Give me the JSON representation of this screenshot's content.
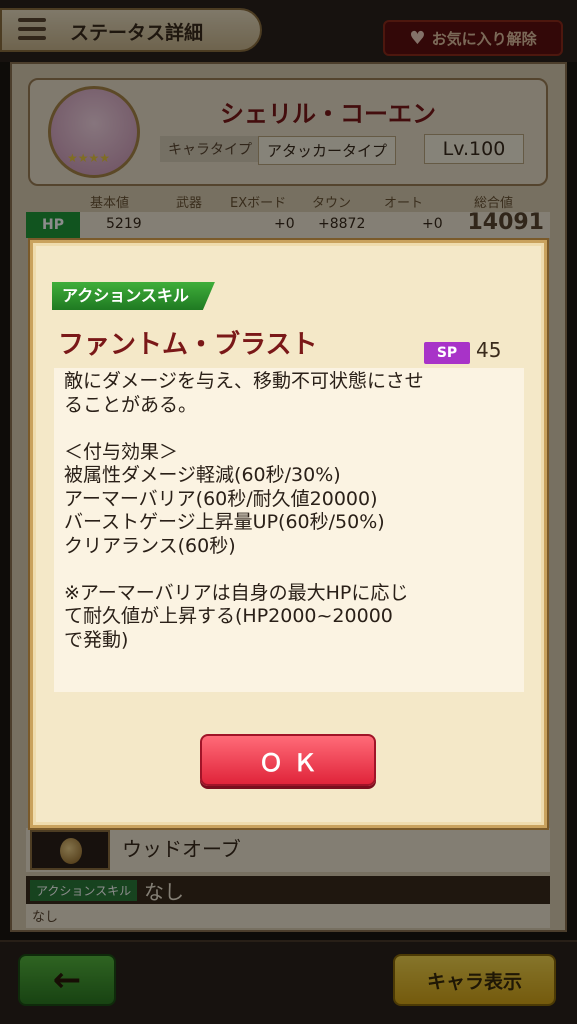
{
  "header": {
    "title": "ステータス詳細",
    "favorite_label": "お気に入り解除"
  },
  "character": {
    "name": "シェリル・コーエン",
    "type_label": "キャラタイプ",
    "type_value": "アタッカータイプ",
    "level": "Lv.100"
  },
  "stats": {
    "headers": [
      "基本値",
      "武器",
      "EXボード",
      "タウン",
      "オート",
      "総合値"
    ],
    "hp": {
      "label": "HP",
      "base": "5219",
      "exboard": "+0",
      "town": "+8872",
      "auto": "+0",
      "total": "14091"
    }
  },
  "orb": {
    "name": "ウッドオーブ",
    "skill_label": "アクションスキル",
    "skill_value": "なし",
    "skill_detail": "なし"
  },
  "footer": {
    "back_label": "←",
    "chara_label": "キャラ表示"
  },
  "dialog": {
    "skill_type": "アクションスキル",
    "skill_name": "ファントム・ブラスト",
    "sp_label": "SP",
    "sp_value": "45",
    "description_lines": [
      "敵にダメージを与え、移動不可状態にさせ",
      "ることがある。",
      "",
      "＜付与効果＞",
      "被属性ダメージ軽減(60秒/30%)",
      "アーマーバリア(60秒/耐久値20000)",
      "バーストゲージ上昇量UP(60秒/50%)",
      "クリアランス(60秒)",
      "",
      "※アーマーバリアは自身の最大HPに応じ",
      "て耐久値が上昇する(HP2000~20000",
      "で発動)"
    ],
    "ok_label": "ＯＫ"
  }
}
